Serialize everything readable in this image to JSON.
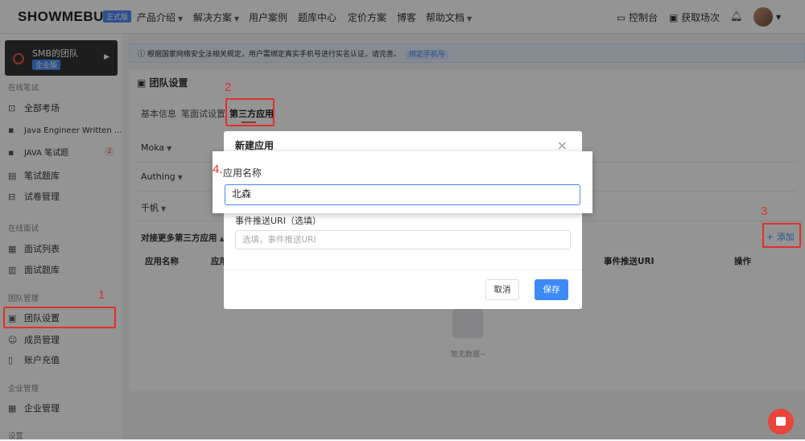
{
  "header": {
    "logo": "SHOWMEBUG",
    "logo_badge": "正式版",
    "nav": [
      "产品介绍",
      "解决方案",
      "用户案例",
      "题库中心",
      "定价方案",
      "博客",
      "帮助文档"
    ],
    "console": "控制台",
    "get_sessions": "获取场次"
  },
  "sidebar": {
    "team_name": "SMB的团队",
    "team_tag": "企业版",
    "sections": {
      "written": "在线笔试",
      "interview": "在线面试",
      "team": "团队管理",
      "enterprise": "企业管理",
      "settings": "设置"
    },
    "items": {
      "all_exams": "全部考场",
      "java_written": "Java Engineer Written ...",
      "java_exam": "JAVA 笔试题",
      "java_badge": "2",
      "question_bank": "笔试题库",
      "paper_manage": "试卷管理",
      "interview_list": "面试列表",
      "interview_bank": "面试题库",
      "team_settings": "团队设置",
      "members": "成员管理",
      "recharge": "账户充值",
      "enterprise": "企业管理"
    }
  },
  "main": {
    "notice": "根据国家网络安全法相关规定，用户需绑定真实手机号进行实名认证，请完善。",
    "notice_link": "绑定手机号",
    "title": "团队设置",
    "tabs": [
      "基本信息",
      "笔面试设置",
      "第三方应用"
    ],
    "rows": [
      "Moka",
      "Authing",
      "千帆"
    ],
    "more_apps": "对接更多第三方应用",
    "add": "+ 添加",
    "table_headers": [
      "应用名称",
      "应用",
      "事件推送URI",
      "操作"
    ],
    "empty": "暂无数据~"
  },
  "modal": {
    "title": "新建应用",
    "uri_label": "事件推送URI（选填）",
    "uri_placeholder": "选填，事件推送URI",
    "cancel": "取消",
    "save": "保存"
  },
  "popup": {
    "label": "应用名称",
    "value": "北森"
  },
  "annotations": {
    "a1": "1",
    "a2": "2",
    "a3": "3",
    "a4": "4."
  }
}
